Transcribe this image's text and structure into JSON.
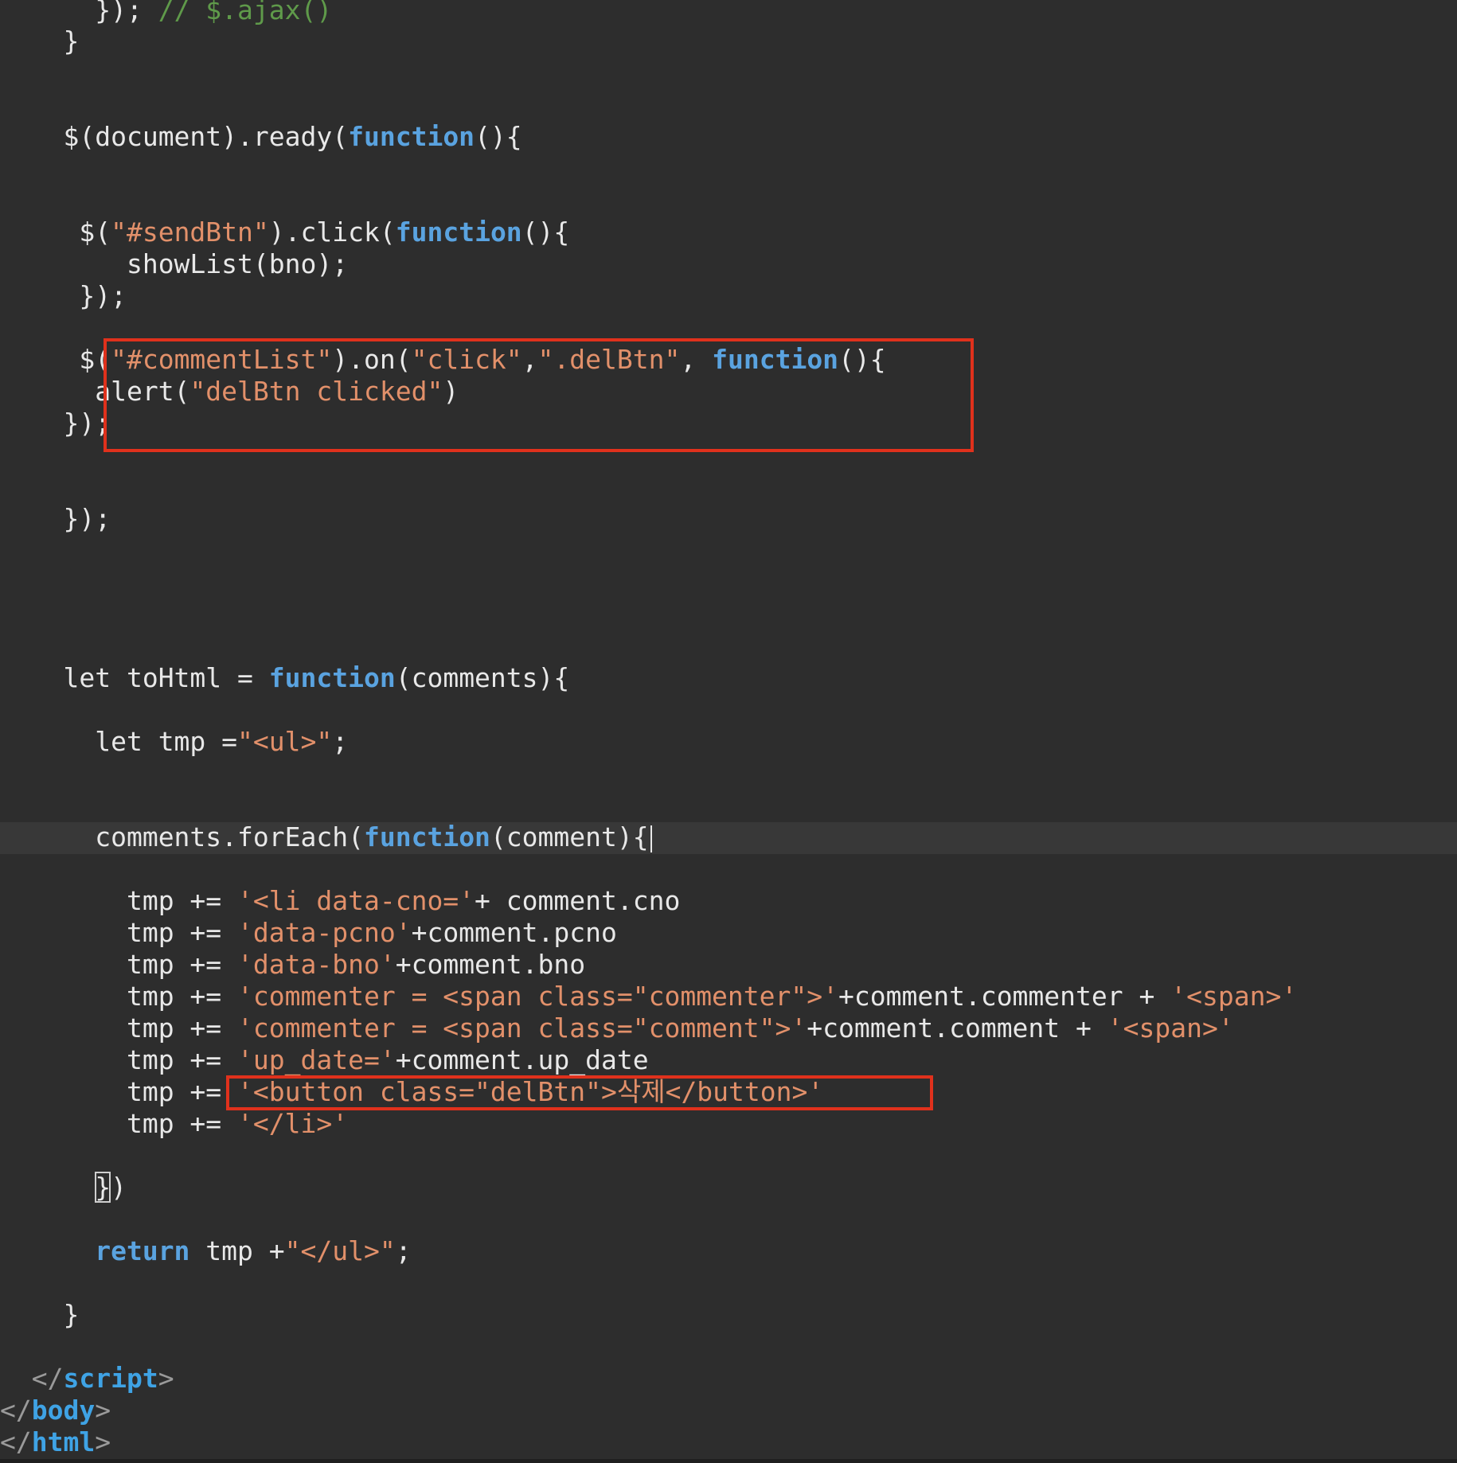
{
  "editor": {
    "code": {
      "l1_a": "});",
      "l1_comment": " // $.ajax()",
      "l2": "}",
      "l3_a": "$(document).ready(",
      "l3_kw": "function",
      "l3_b": "(){",
      "l4_a": "$(",
      "l4_str": "\"#sendBtn\"",
      "l4_b": ").click(",
      "l4_kw": "function",
      "l4_c": "(){",
      "l5": "showList(bno);",
      "l6": "});",
      "l7_a": "$(",
      "l7_str1": "\"#commentList\"",
      "l7_b": ").on(",
      "l7_str2": "\"click\"",
      "l7_c": ",",
      "l7_str3": "\".delBtn\"",
      "l7_d": ", ",
      "l7_kw": "function",
      "l7_e": "(){",
      "l8_a": "alert(",
      "l8_str": "\"delBtn clicked\"",
      "l8_b": ")",
      "l9": "});",
      "l10": "});",
      "l11_a": "let toHtml = ",
      "l11_kw": "function",
      "l11_b": "(comments){",
      "l12_a": "let tmp =",
      "l12_str": "\"<ul>\"",
      "l12_b": ";",
      "l13_a": "comments.forEach(",
      "l13_kw": "function",
      "l13_b": "(comment){",
      "l14_a": "tmp += ",
      "l14_str": "'<li data-cno='",
      "l14_b": "+ comment.cno",
      "l15_a": "tmp += ",
      "l15_str": "'data-pcno'",
      "l15_b": "+comment.pcno",
      "l16_a": "tmp += ",
      "l16_str": "'data-bno'",
      "l16_b": "+comment.bno",
      "l17_a": "tmp += ",
      "l17_str": "'commenter = <span class=\"commenter\">'",
      "l17_b": "+comment.commenter + ",
      "l17_str2": "'<span>'",
      "l18_a": "tmp += ",
      "l18_str": "'commenter = <span class=\"comment\">'",
      "l18_b": "+comment.comment + ",
      "l18_str2": "'<span>'",
      "l19_a": "tmp += ",
      "l19_str": "'up_date='",
      "l19_b": "+comment.up_date",
      "l20_a": "tmp += ",
      "l20_str": "'<button class=\"delBtn\">삭제</button>'",
      "l21_a": "tmp += ",
      "l21_str": "'</li>'",
      "l22_a": "}",
      "l22_b": ")",
      "l23_kw": "return",
      "l23_a": " tmp +",
      "l23_str": "\"</ul>\"",
      "l23_b": ";",
      "l24": "}",
      "l25_open": "</",
      "l25_tag": "script",
      "l25_close": ">",
      "l26_open": "</",
      "l26_tag": "body",
      "l26_close": ">",
      "l27_open": "</",
      "l27_tag": "html",
      "l27_close": ">"
    },
    "colors": {
      "background": "#2d2d2d",
      "keyword": "#5aa3e0",
      "string": "#e2906a",
      "comment": "#5f9a4a",
      "tag": "#3fa3e5",
      "highlight_box": "#e0311c"
    }
  }
}
